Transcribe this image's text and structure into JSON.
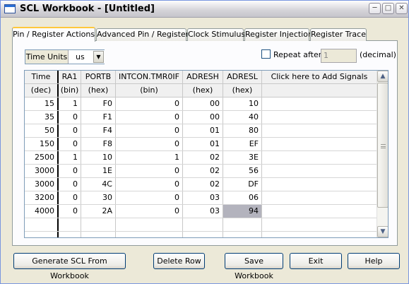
{
  "window": {
    "title": "SCL Workbook - [Untitled]"
  },
  "tabs": [
    {
      "label": "Pin / Register Actions",
      "active": true
    },
    {
      "label": "Advanced Pin / Register",
      "active": false
    },
    {
      "label": "Clock Stimulus",
      "active": false
    },
    {
      "label": "Register Injection",
      "active": false
    },
    {
      "label": "Register Trace",
      "active": false
    }
  ],
  "controls": {
    "time_units_label": "Time Units",
    "time_units_value": "us",
    "repeat_label": "Repeat after",
    "repeat_value": "1",
    "repeat_unit": "(decimal)",
    "repeat_checked": false
  },
  "grid": {
    "headers": [
      "Time",
      "RA1",
      "PORTB",
      "INTCON.TMR0IF",
      "ADRESH",
      "ADRESL",
      "Click here to Add Signals"
    ],
    "subheaders": [
      "(dec)",
      "(bin)",
      "(hex)",
      "(bin)",
      "(hex)",
      "(hex)",
      ""
    ],
    "rows": [
      [
        "15",
        "1",
        "F0",
        "0",
        "00",
        "10"
      ],
      [
        "35",
        "0",
        "F1",
        "0",
        "00",
        "40"
      ],
      [
        "50",
        "0",
        "F4",
        "0",
        "01",
        "80"
      ],
      [
        "150",
        "0",
        "F8",
        "0",
        "01",
        "EF"
      ],
      [
        "2500",
        "1",
        "10",
        "1",
        "02",
        "3E"
      ],
      [
        "3000",
        "0",
        "1E",
        "0",
        "02",
        "56"
      ],
      [
        "3000",
        "0",
        "4C",
        "0",
        "02",
        "DF"
      ],
      [
        "3200",
        "0",
        "30",
        "0",
        "03",
        "06"
      ],
      [
        "4000",
        "0",
        "2A",
        "0",
        "03",
        "94"
      ]
    ],
    "selected_cell": {
      "row": 8,
      "col": 5
    }
  },
  "buttons": {
    "generate": "Generate SCL From Workbook",
    "delete_row": "Delete Row",
    "save": "Save Workbook",
    "exit": "Exit",
    "help": "Help"
  },
  "icons": {
    "minimize": "minimize-icon",
    "maximize": "maximize-icon",
    "close": "close-icon",
    "dropdown": "chevron-down-icon",
    "scroll_up": "chevron-up-icon",
    "scroll_down": "chevron-down-icon"
  }
}
